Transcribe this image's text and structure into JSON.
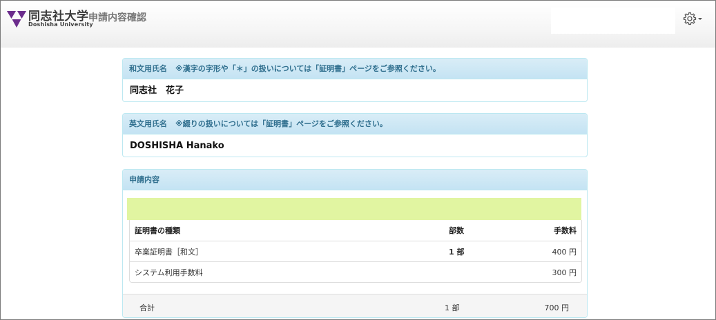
{
  "header": {
    "university_jp": "同志社大学",
    "university_en": "Doshisha University",
    "page_title": "申請内容確認",
    "settings_icon": "gear-icon",
    "logo_color": "#6b2c8c"
  },
  "japanese_name_panel": {
    "heading": "和文用氏名",
    "note": "※漢字の字形や「＊」の扱いについては「証明書」ページをご参照ください。",
    "value": "同志社　花子"
  },
  "english_name_panel": {
    "heading": "英文用氏名",
    "note": "※綴りの扱いについては「証明書」ページをご参照ください。",
    "value": "DOSHISHA Hanako"
  },
  "application_panel": {
    "heading": "申請内容",
    "table": {
      "headers": [
        "証明書の種類",
        "部数",
        "手数料"
      ],
      "rows": [
        [
          "卒業証明書［和文］",
          "1 部",
          "400 円"
        ],
        [
          "システム利用手数料",
          "",
          "300 円"
        ]
      ]
    },
    "total": {
      "label": "合計",
      "count": "1 部",
      "fee": "700 円"
    }
  },
  "colors": {
    "panel_heading_text": "#31708f",
    "panel_border": "#bce8f1",
    "highlight_bar": "#e1f5a1"
  }
}
